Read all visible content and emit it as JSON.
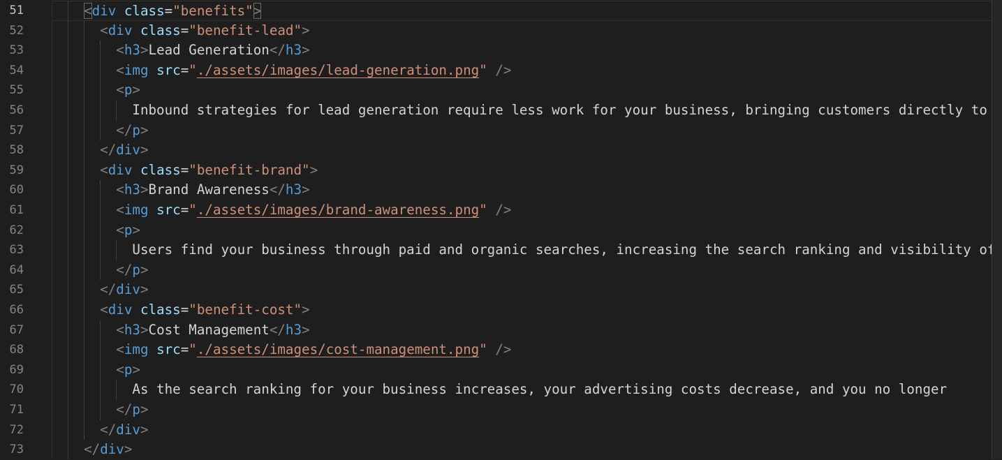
{
  "editor": {
    "current_line": 51,
    "lines": [
      {
        "num": "51",
        "indent": 2,
        "tokens": [
          {
            "c": "p",
            "t": "<",
            "m": 1
          },
          {
            "c": "t",
            "t": "div"
          },
          {
            "c": "x",
            "t": " "
          },
          {
            "c": "a",
            "t": "class"
          },
          {
            "c": "x",
            "t": "="
          },
          {
            "c": "s",
            "t": "\"benefits\""
          },
          {
            "c": "p",
            "t": ">",
            "m": 1
          }
        ]
      },
      {
        "num": "52",
        "indent": 4,
        "tokens": [
          {
            "c": "p",
            "t": "<"
          },
          {
            "c": "t",
            "t": "div"
          },
          {
            "c": "x",
            "t": " "
          },
          {
            "c": "a",
            "t": "class"
          },
          {
            "c": "x",
            "t": "="
          },
          {
            "c": "s",
            "t": "\"benefit-lead\""
          },
          {
            "c": "p",
            "t": ">"
          }
        ]
      },
      {
        "num": "53",
        "indent": 6,
        "tokens": [
          {
            "c": "p",
            "t": "<"
          },
          {
            "c": "t",
            "t": "h3"
          },
          {
            "c": "p",
            "t": ">"
          },
          {
            "c": "x",
            "t": "Lead Generation"
          },
          {
            "c": "p",
            "t": "</"
          },
          {
            "c": "t",
            "t": "h3"
          },
          {
            "c": "p",
            "t": ">"
          }
        ]
      },
      {
        "num": "54",
        "indent": 6,
        "tokens": [
          {
            "c": "p",
            "t": "<"
          },
          {
            "c": "t",
            "t": "img"
          },
          {
            "c": "x",
            "t": " "
          },
          {
            "c": "a",
            "t": "src"
          },
          {
            "c": "x",
            "t": "="
          },
          {
            "c": "s",
            "t": "\""
          },
          {
            "c": "s",
            "t": "./assets/images/lead-generation.png",
            "u": 1
          },
          {
            "c": "s",
            "t": "\""
          },
          {
            "c": "x",
            "t": " "
          },
          {
            "c": "p",
            "t": "/>"
          }
        ]
      },
      {
        "num": "55",
        "indent": 6,
        "tokens": [
          {
            "c": "p",
            "t": "<"
          },
          {
            "c": "t",
            "t": "p"
          },
          {
            "c": "p",
            "t": ">"
          }
        ]
      },
      {
        "num": "56",
        "indent": 8,
        "tokens": [
          {
            "c": "x",
            "t": "Inbound strategies for lead generation require less work for your business, bringing customers directly to your website."
          }
        ]
      },
      {
        "num": "57",
        "indent": 6,
        "tokens": [
          {
            "c": "p",
            "t": "</"
          },
          {
            "c": "t",
            "t": "p"
          },
          {
            "c": "p",
            "t": ">"
          }
        ]
      },
      {
        "num": "58",
        "indent": 4,
        "tokens": [
          {
            "c": "p",
            "t": "</"
          },
          {
            "c": "t",
            "t": "div"
          },
          {
            "c": "p",
            "t": ">"
          }
        ]
      },
      {
        "num": "59",
        "indent": 4,
        "tokens": [
          {
            "c": "p",
            "t": "<"
          },
          {
            "c": "t",
            "t": "div"
          },
          {
            "c": "x",
            "t": " "
          },
          {
            "c": "a",
            "t": "class"
          },
          {
            "c": "x",
            "t": "="
          },
          {
            "c": "s",
            "t": "\"benefit-brand\""
          },
          {
            "c": "p",
            "t": ">"
          }
        ]
      },
      {
        "num": "60",
        "indent": 6,
        "tokens": [
          {
            "c": "p",
            "t": "<"
          },
          {
            "c": "t",
            "t": "h3"
          },
          {
            "c": "p",
            "t": ">"
          },
          {
            "c": "x",
            "t": "Brand Awareness"
          },
          {
            "c": "p",
            "t": "</"
          },
          {
            "c": "t",
            "t": "h3"
          },
          {
            "c": "p",
            "t": ">"
          }
        ]
      },
      {
        "num": "61",
        "indent": 6,
        "tokens": [
          {
            "c": "p",
            "t": "<"
          },
          {
            "c": "t",
            "t": "img"
          },
          {
            "c": "x",
            "t": " "
          },
          {
            "c": "a",
            "t": "src"
          },
          {
            "c": "x",
            "t": "="
          },
          {
            "c": "s",
            "t": "\""
          },
          {
            "c": "s",
            "t": "./assets/images/brand-awareness.png",
            "u": 1
          },
          {
            "c": "s",
            "t": "\""
          },
          {
            "c": "x",
            "t": " "
          },
          {
            "c": "p",
            "t": "/>"
          }
        ]
      },
      {
        "num": "62",
        "indent": 6,
        "tokens": [
          {
            "c": "p",
            "t": "<"
          },
          {
            "c": "t",
            "t": "p"
          },
          {
            "c": "p",
            "t": ">"
          }
        ]
      },
      {
        "num": "63",
        "indent": 8,
        "tokens": [
          {
            "c": "x",
            "t": "Users find your business through paid and organic searches, increasing the search ranking and visibility of your business."
          }
        ]
      },
      {
        "num": "64",
        "indent": 6,
        "tokens": [
          {
            "c": "p",
            "t": "</"
          },
          {
            "c": "t",
            "t": "p"
          },
          {
            "c": "p",
            "t": ">"
          }
        ]
      },
      {
        "num": "65",
        "indent": 4,
        "tokens": [
          {
            "c": "p",
            "t": "</"
          },
          {
            "c": "t",
            "t": "div"
          },
          {
            "c": "p",
            "t": ">"
          }
        ]
      },
      {
        "num": "66",
        "indent": 4,
        "tokens": [
          {
            "c": "p",
            "t": "<"
          },
          {
            "c": "t",
            "t": "div"
          },
          {
            "c": "x",
            "t": " "
          },
          {
            "c": "a",
            "t": "class"
          },
          {
            "c": "x",
            "t": "="
          },
          {
            "c": "s",
            "t": "\"benefit-cost\""
          },
          {
            "c": "p",
            "t": ">"
          }
        ]
      },
      {
        "num": "67",
        "indent": 6,
        "tokens": [
          {
            "c": "p",
            "t": "<"
          },
          {
            "c": "t",
            "t": "h3"
          },
          {
            "c": "p",
            "t": ">"
          },
          {
            "c": "x",
            "t": "Cost Management"
          },
          {
            "c": "p",
            "t": "</"
          },
          {
            "c": "t",
            "t": "h3"
          },
          {
            "c": "p",
            "t": ">"
          }
        ]
      },
      {
        "num": "68",
        "indent": 6,
        "tokens": [
          {
            "c": "p",
            "t": "<"
          },
          {
            "c": "t",
            "t": "img"
          },
          {
            "c": "x",
            "t": " "
          },
          {
            "c": "a",
            "t": "src"
          },
          {
            "c": "x",
            "t": "="
          },
          {
            "c": "s",
            "t": "\""
          },
          {
            "c": "s",
            "t": "./assets/images/cost-management.png",
            "u": 1
          },
          {
            "c": "s",
            "t": "\""
          },
          {
            "c": "x",
            "t": " "
          },
          {
            "c": "p",
            "t": "/>"
          }
        ]
      },
      {
        "num": "69",
        "indent": 6,
        "tokens": [
          {
            "c": "p",
            "t": "<"
          },
          {
            "c": "t",
            "t": "p"
          },
          {
            "c": "p",
            "t": ">"
          }
        ]
      },
      {
        "num": "70",
        "indent": 8,
        "tokens": [
          {
            "c": "x",
            "t": "As the search ranking for your business increases, your advertising costs decrease, and you no longer"
          }
        ]
      },
      {
        "num": "71",
        "indent": 6,
        "tokens": [
          {
            "c": "p",
            "t": "</"
          },
          {
            "c": "t",
            "t": "p"
          },
          {
            "c": "p",
            "t": ">"
          }
        ]
      },
      {
        "num": "72",
        "indent": 4,
        "tokens": [
          {
            "c": "p",
            "t": "</"
          },
          {
            "c": "t",
            "t": "div"
          },
          {
            "c": "p",
            "t": ">"
          }
        ]
      },
      {
        "num": "73",
        "indent": 2,
        "tokens": [
          {
            "c": "p",
            "t": "</"
          },
          {
            "c": "t",
            "t": "div"
          },
          {
            "c": "p",
            "t": ">"
          }
        ]
      }
    ]
  },
  "colors": {
    "background": "#1e1e1e",
    "tag": "#569cd6",
    "attribute": "#9cdcfe",
    "string": "#ce9178",
    "punctuation": "#808080",
    "text": "#d4d4d4",
    "line_number": "#858585",
    "line_number_active": "#c6c6c6"
  }
}
